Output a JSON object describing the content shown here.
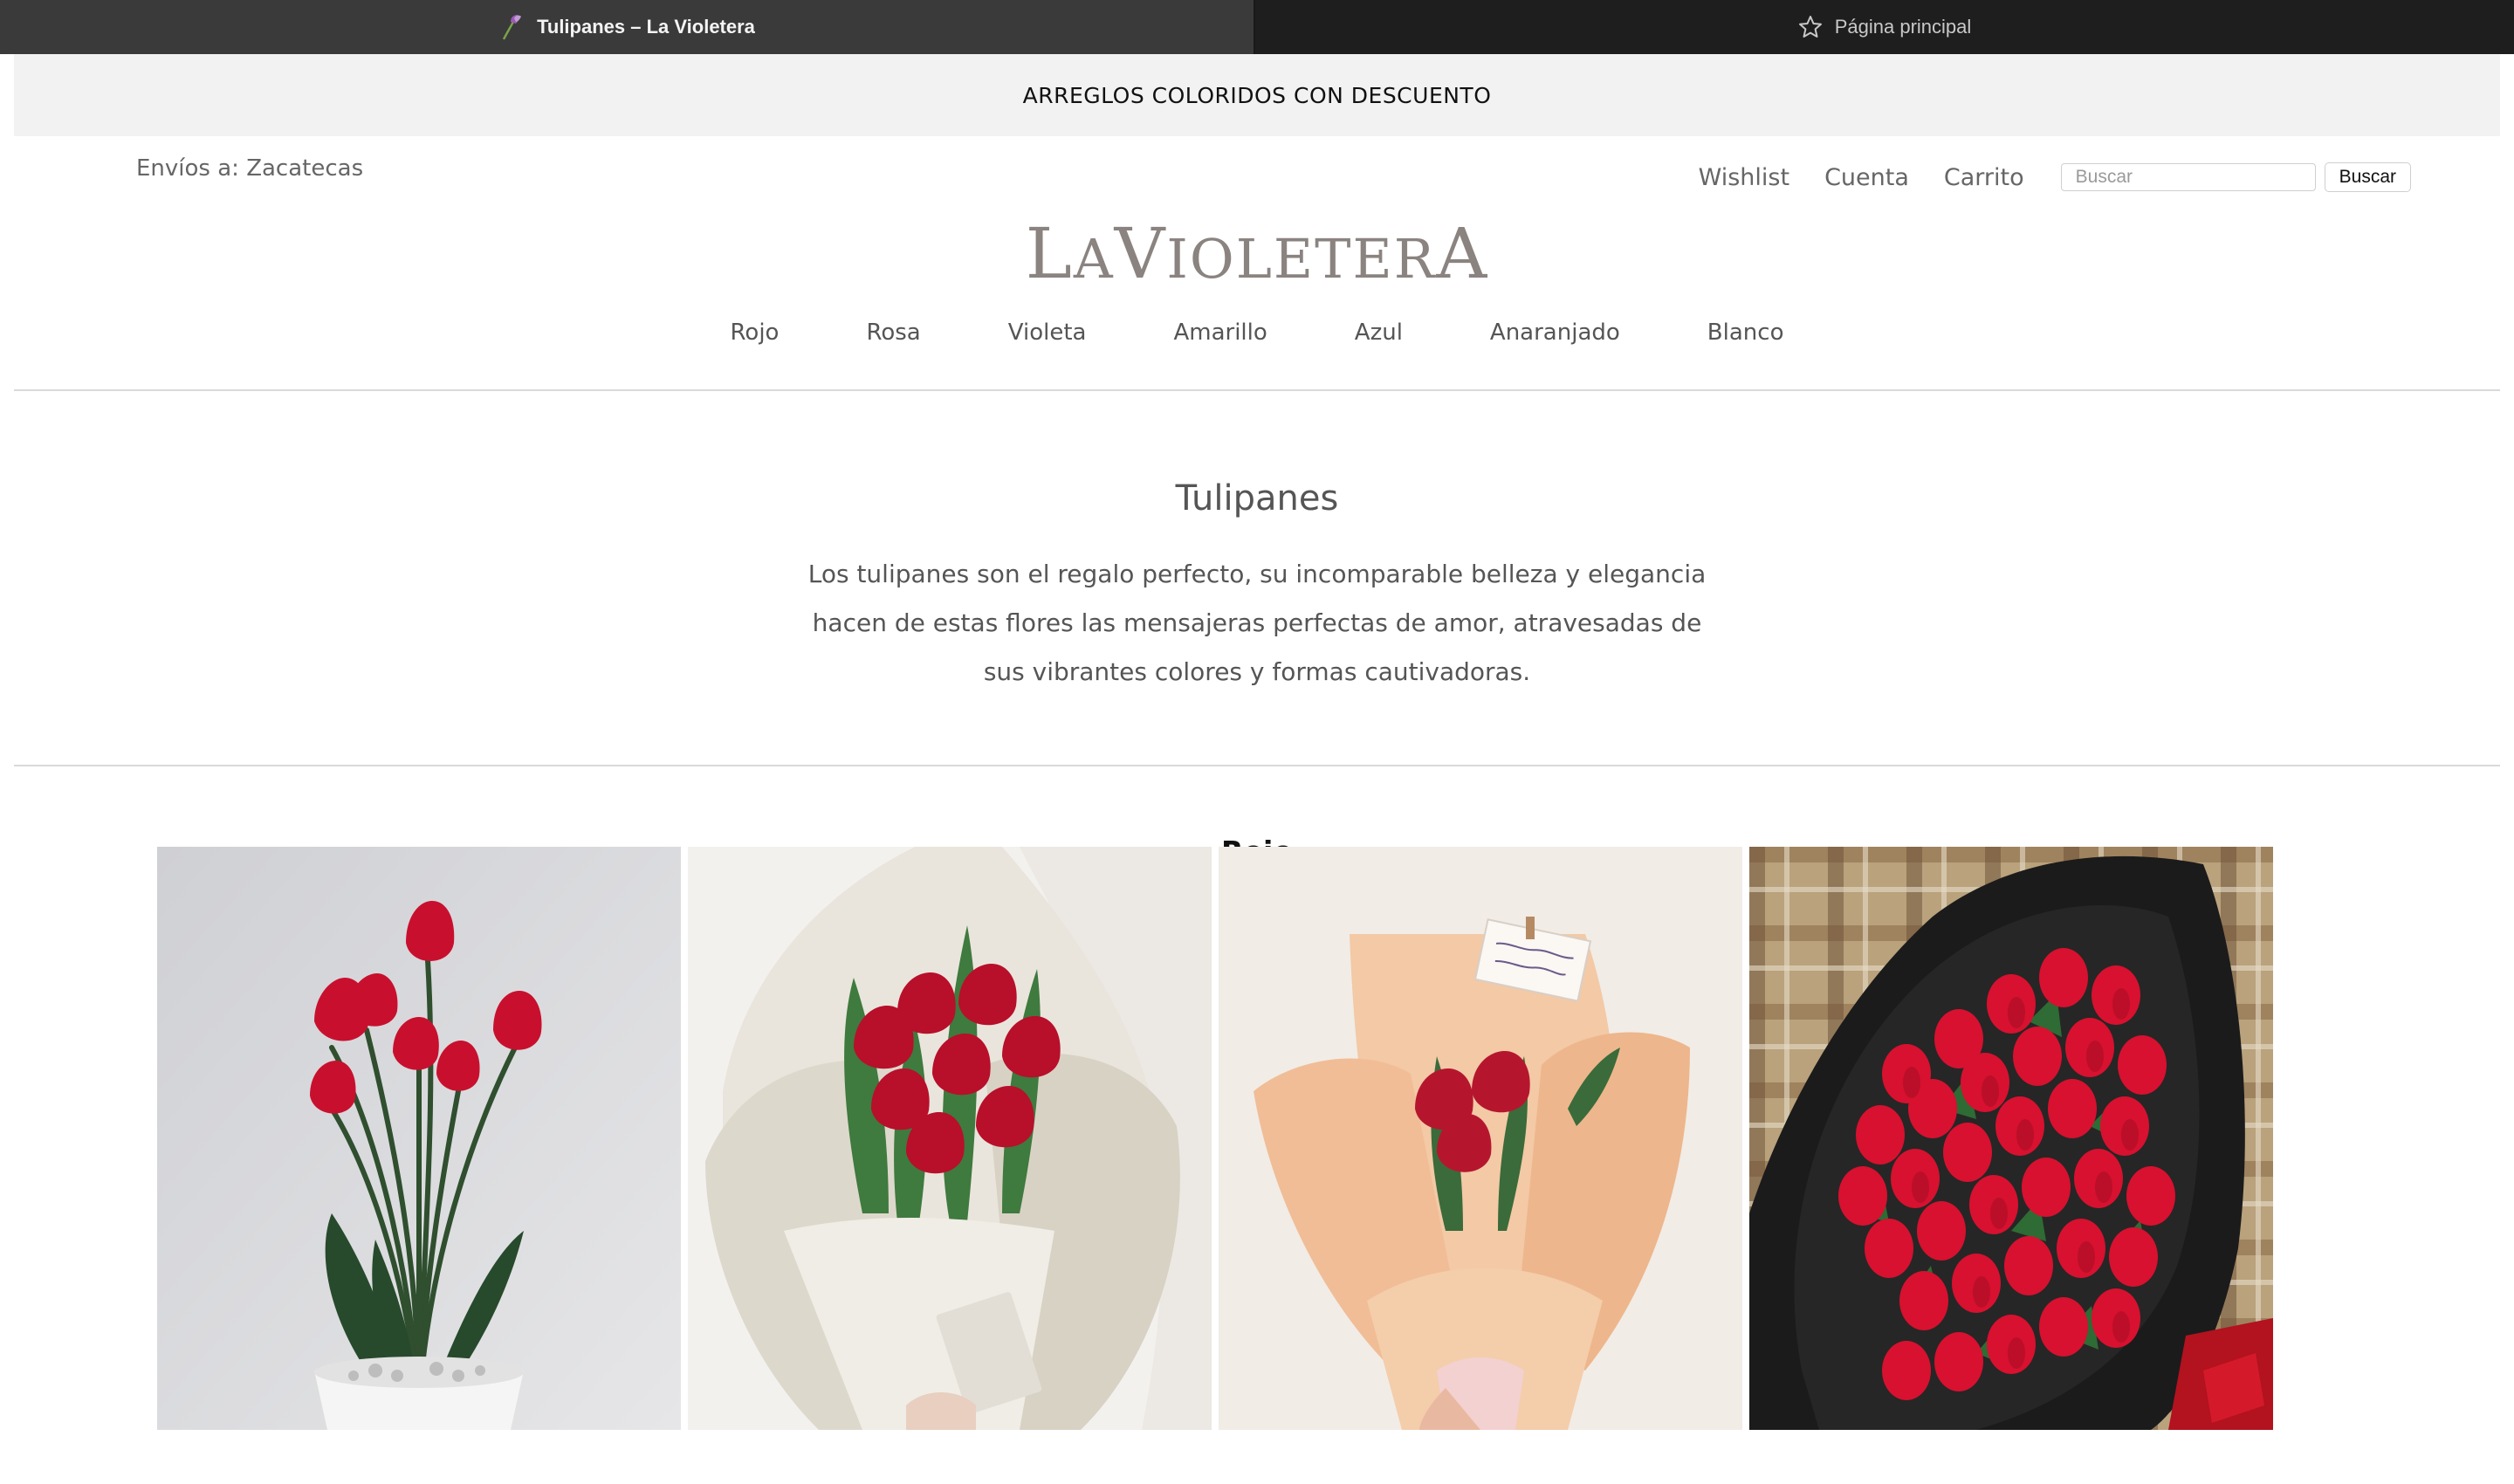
{
  "browser": {
    "active_tab": "Tulipanes – La Violetera",
    "inactive_tab": "Página principal"
  },
  "announcement": "ARREGLOS COLORIDOS CON DESCUENTO",
  "header": {
    "shipping": "Envíos a: Zacatecas",
    "links": [
      "Wishlist",
      "Cuenta",
      "Carrito"
    ],
    "search_placeholder": "Buscar",
    "search_button": "Buscar",
    "logo_letters": [
      "L",
      "A",
      "V",
      "IOLETER",
      "A"
    ]
  },
  "nav": [
    "Rojo",
    "Rosa",
    "Violeta",
    "Amarillo",
    "Azul",
    "Anaranjado",
    "Blanco"
  ],
  "category": {
    "title": "Tulipanes",
    "description": "Los tulipanes son el regalo perfecto, su incomparable belleza y elegancia hacen de estas flores las mensajeras perfectas de amor, atravesadas de sus vibrantes colores y formas cautivadoras."
  },
  "section": {
    "title": "Rojo"
  },
  "colors": {
    "tulip_red": "#c8102e",
    "leaf_green": "#3b6b3a",
    "logo_gray": "#8a8380"
  }
}
